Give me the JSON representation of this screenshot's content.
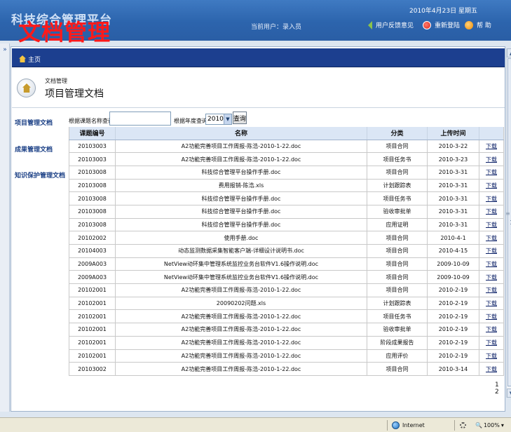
{
  "header": {
    "app_title": "科技综合管理平台",
    "overlay_title": "文档管理",
    "date": "2010年4月23日 星期五",
    "current_user": "当前用户：录入员",
    "links": {
      "feedback": "用户反馈意见",
      "relogin": "重新登陆",
      "help": "帮 助"
    }
  },
  "nav": {
    "home": "主页",
    "collapse": "»"
  },
  "page": {
    "breadcrumb": "文档管理",
    "title": "项目管理文档"
  },
  "sidebar": {
    "items": [
      "项目管理文档",
      "成果管理文档",
      "知识保护管理文档"
    ]
  },
  "search": {
    "title_label": "根据课题名称查询",
    "title_value": "",
    "year_label": "根据年度查询",
    "year_value": "2010",
    "query_button": "查询"
  },
  "table": {
    "headers": [
      "课题编号",
      "名称",
      "分类",
      "上传时间",
      ""
    ],
    "download_label": "下载",
    "rows": [
      [
        "20103003",
        "A2功能完善项目工作周报-陈浩-2010-1-22.doc",
        "项目合同",
        "2010-3-22"
      ],
      [
        "20103003",
        "A2功能完善项目工作周报-陈浩-2010-1-22.doc",
        "项目任务书",
        "2010-3-23"
      ],
      [
        "20103008",
        "科技综合管理平台操作手册.doc",
        "项目合同",
        "2010-3-31"
      ],
      [
        "20103008",
        "费用报销-陈浩.xls",
        "计划跟踪表",
        "2010-3-31"
      ],
      [
        "20103008",
        "科技综合管理平台操作手册.doc",
        "项目任务书",
        "2010-3-31"
      ],
      [
        "20103008",
        "科技综合管理平台操作手册.doc",
        "验收审批单",
        "2010-3-31"
      ],
      [
        "20103008",
        "科技综合管理平台操作手册.doc",
        "应用证明",
        "2010-3-31"
      ],
      [
        "20102002",
        "使用手册.doc",
        "项目合同",
        "2010-4-1"
      ],
      [
        "20104003",
        "动态监测数据采集智能客户端-详细设计说明书.doc",
        "项目合同",
        "2010-4-15"
      ],
      [
        "2009A003",
        "NetView动环集中管理系统监控业务台软件V1.6操作说明.doc",
        "项目合同",
        "2009-10-09"
      ],
      [
        "2009A003",
        "NetView动环集中管理系统监控业务台软件V1.6操作说明.doc",
        "项目合同",
        "2009-10-09"
      ],
      [
        "20102001",
        "A2功能完善项目工作周报-陈浩-2010-1-22.doc",
        "项目合同",
        "2010-2-19"
      ],
      [
        "20102001",
        "20090202问题.xls",
        "计划跟踪表",
        "2010-2-19"
      ],
      [
        "20102001",
        "A2功能完善项目工作周报-陈浩-2010-1-22.doc",
        "项目任务书",
        "2010-2-19"
      ],
      [
        "20102001",
        "A2功能完善项目工作周报-陈浩-2010-1-22.doc",
        "验收审批单",
        "2010-2-19"
      ],
      [
        "20102001",
        "A2功能完善项目工作周报-陈浩-2010-1-22.doc",
        "阶段成果报告",
        "2010-2-19"
      ],
      [
        "20102001",
        "A2功能完善项目工作周报-陈浩-2010-1-22.doc",
        "应用评价",
        "2010-2-19"
      ],
      [
        "20103002",
        "A2功能完善项目工作周报-陈浩-2010-1-22.doc",
        "项目合同",
        "2010-3-14"
      ]
    ]
  },
  "pager": {
    "pages": [
      "1",
      "2"
    ]
  },
  "statusbar": {
    "zone": "Internet",
    "zoom": "100%"
  }
}
